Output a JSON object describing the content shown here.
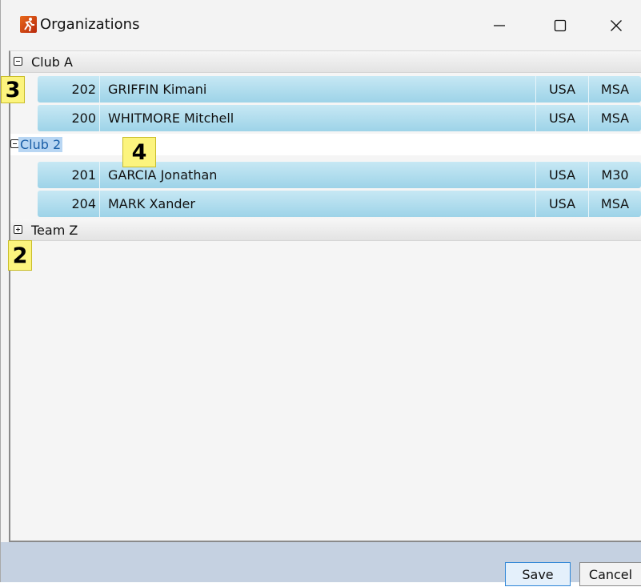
{
  "window": {
    "title": "Organizations",
    "icon": "app-runner-icon"
  },
  "groups": [
    {
      "label": "Club A",
      "expanded": true
    },
    {
      "label": "Club 2",
      "expanded": true,
      "selected": true
    },
    {
      "label": "Team Z",
      "expanded": false
    }
  ],
  "athletes": [
    {
      "number": "202",
      "name": "GRIFFIN Kimani",
      "nation": "USA",
      "category": "MSA"
    },
    {
      "number": "200",
      "name": "WHITMORE Mitchell",
      "nation": "USA",
      "category": "MSA"
    },
    {
      "number": "201",
      "name": "GARCIA Jonathan",
      "nation": "USA",
      "category": "M30"
    },
    {
      "number": "204",
      "name": "MARK Xander",
      "nation": "USA",
      "category": "MSA"
    }
  ],
  "markers": [
    "3",
    "4",
    "2"
  ],
  "footer": {
    "save_label": "Save",
    "cancel_label": "Cancel"
  },
  "colors": {
    "row_gradient_top": "#c7e8f4",
    "row_gradient_bottom": "#9dd3e8",
    "footer": "#c5d1e1",
    "marker": "#fcf47e"
  }
}
